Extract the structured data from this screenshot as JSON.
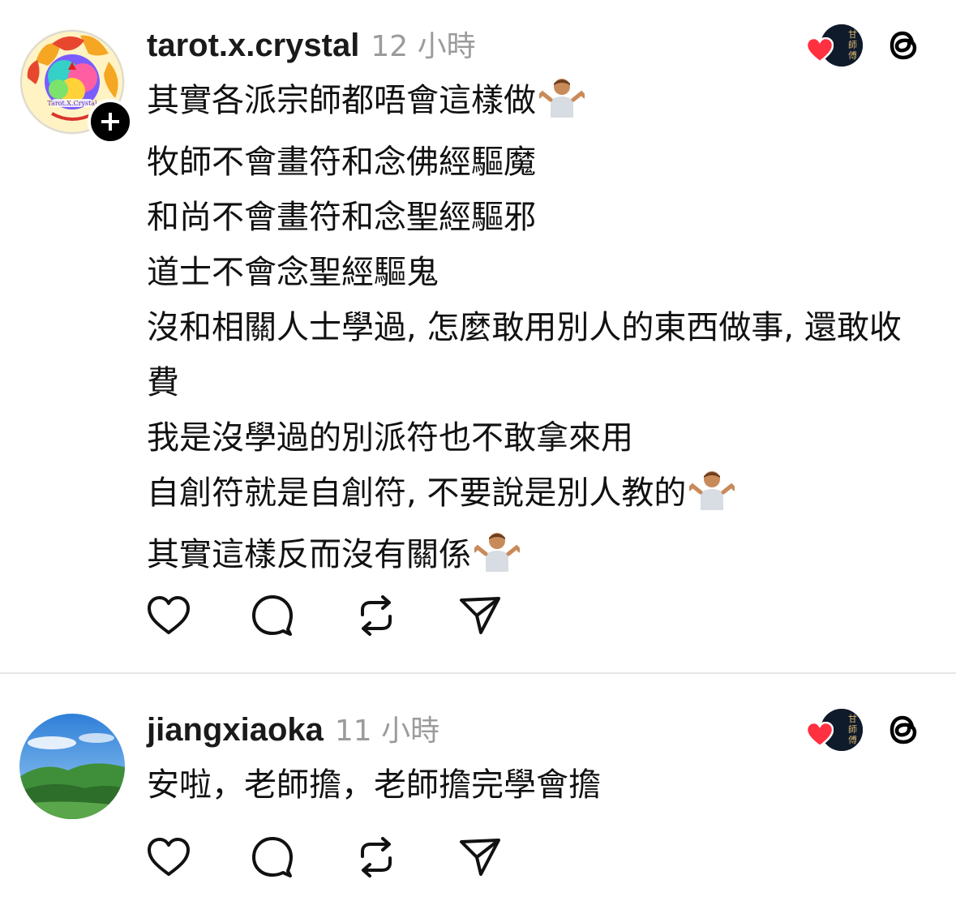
{
  "posts": [
    {
      "username": "tarot.x.crystal",
      "time": "12 小時",
      "avatar_logo_text": "Tarot.X.Crystal",
      "lines": [
        "其實各派宗師都唔會這樣做",
        "牧師不會畫符和念佛經驅魔",
        "和尚不會畫符和念聖經驅邪",
        "道士不會念聖經驅鬼",
        "沒和相關人士學過, 怎麼敢用別人的東西做事, 還敢收費",
        "我是沒學過的別派符也不敢拿來用",
        "自創符就是自創符, 不要說是別人教的",
        "其實這樣反而沒有關係"
      ],
      "emoji_icon": "person-shrugging-emoji",
      "liked_by_icon": "heart-icon",
      "liked_by_avatar_text": "甘師傅"
    },
    {
      "username": "jiangxiaoka",
      "time": "11 小時",
      "lines": [
        "安啦，老師擔，老師擔完學會擔"
      ],
      "liked_by_icon": "heart-icon",
      "liked_by_avatar_text": "甘師傅"
    }
  ],
  "actions": {
    "like": "heart-outline-icon",
    "comment": "comment-bubble-icon",
    "repost": "repost-icon",
    "share": "send-icon"
  },
  "colors": {
    "text": "#111111",
    "muted": "#9b9b9b",
    "heart": "#ff3040",
    "divider": "#e6e6e6"
  }
}
